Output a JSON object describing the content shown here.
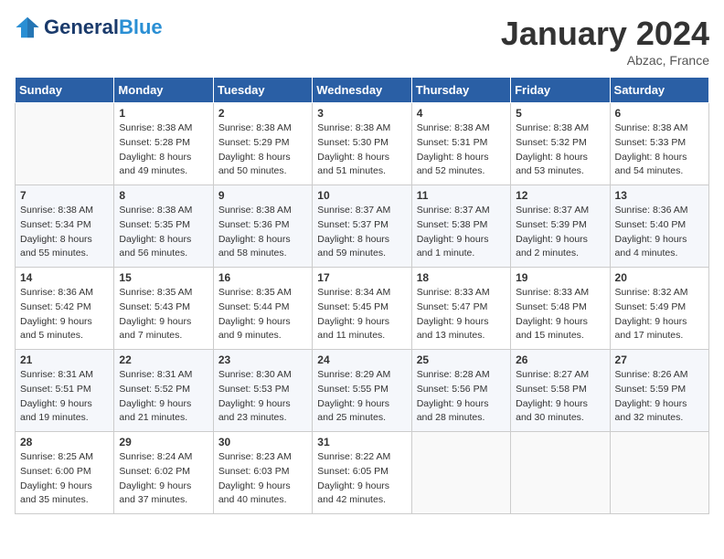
{
  "header": {
    "logo_general": "General",
    "logo_blue": "Blue",
    "month_title": "January 2024",
    "location": "Abzac, France"
  },
  "weekdays": [
    "Sunday",
    "Monday",
    "Tuesday",
    "Wednesday",
    "Thursday",
    "Friday",
    "Saturday"
  ],
  "weeks": [
    [
      {
        "day": "",
        "sunrise": "",
        "sunset": "",
        "daylight": ""
      },
      {
        "day": "1",
        "sunrise": "Sunrise: 8:38 AM",
        "sunset": "Sunset: 5:28 PM",
        "daylight": "Daylight: 8 hours and 49 minutes."
      },
      {
        "day": "2",
        "sunrise": "Sunrise: 8:38 AM",
        "sunset": "Sunset: 5:29 PM",
        "daylight": "Daylight: 8 hours and 50 minutes."
      },
      {
        "day": "3",
        "sunrise": "Sunrise: 8:38 AM",
        "sunset": "Sunset: 5:30 PM",
        "daylight": "Daylight: 8 hours and 51 minutes."
      },
      {
        "day": "4",
        "sunrise": "Sunrise: 8:38 AM",
        "sunset": "Sunset: 5:31 PM",
        "daylight": "Daylight: 8 hours and 52 minutes."
      },
      {
        "day": "5",
        "sunrise": "Sunrise: 8:38 AM",
        "sunset": "Sunset: 5:32 PM",
        "daylight": "Daylight: 8 hours and 53 minutes."
      },
      {
        "day": "6",
        "sunrise": "Sunrise: 8:38 AM",
        "sunset": "Sunset: 5:33 PM",
        "daylight": "Daylight: 8 hours and 54 minutes."
      }
    ],
    [
      {
        "day": "7",
        "sunrise": "Sunrise: 8:38 AM",
        "sunset": "Sunset: 5:34 PM",
        "daylight": "Daylight: 8 hours and 55 minutes."
      },
      {
        "day": "8",
        "sunrise": "Sunrise: 8:38 AM",
        "sunset": "Sunset: 5:35 PM",
        "daylight": "Daylight: 8 hours and 56 minutes."
      },
      {
        "day": "9",
        "sunrise": "Sunrise: 8:38 AM",
        "sunset": "Sunset: 5:36 PM",
        "daylight": "Daylight: 8 hours and 58 minutes."
      },
      {
        "day": "10",
        "sunrise": "Sunrise: 8:37 AM",
        "sunset": "Sunset: 5:37 PM",
        "daylight": "Daylight: 8 hours and 59 minutes."
      },
      {
        "day": "11",
        "sunrise": "Sunrise: 8:37 AM",
        "sunset": "Sunset: 5:38 PM",
        "daylight": "Daylight: 9 hours and 1 minute."
      },
      {
        "day": "12",
        "sunrise": "Sunrise: 8:37 AM",
        "sunset": "Sunset: 5:39 PM",
        "daylight": "Daylight: 9 hours and 2 minutes."
      },
      {
        "day": "13",
        "sunrise": "Sunrise: 8:36 AM",
        "sunset": "Sunset: 5:40 PM",
        "daylight": "Daylight: 9 hours and 4 minutes."
      }
    ],
    [
      {
        "day": "14",
        "sunrise": "Sunrise: 8:36 AM",
        "sunset": "Sunset: 5:42 PM",
        "daylight": "Daylight: 9 hours and 5 minutes."
      },
      {
        "day": "15",
        "sunrise": "Sunrise: 8:35 AM",
        "sunset": "Sunset: 5:43 PM",
        "daylight": "Daylight: 9 hours and 7 minutes."
      },
      {
        "day": "16",
        "sunrise": "Sunrise: 8:35 AM",
        "sunset": "Sunset: 5:44 PM",
        "daylight": "Daylight: 9 hours and 9 minutes."
      },
      {
        "day": "17",
        "sunrise": "Sunrise: 8:34 AM",
        "sunset": "Sunset: 5:45 PM",
        "daylight": "Daylight: 9 hours and 11 minutes."
      },
      {
        "day": "18",
        "sunrise": "Sunrise: 8:33 AM",
        "sunset": "Sunset: 5:47 PM",
        "daylight": "Daylight: 9 hours and 13 minutes."
      },
      {
        "day": "19",
        "sunrise": "Sunrise: 8:33 AM",
        "sunset": "Sunset: 5:48 PM",
        "daylight": "Daylight: 9 hours and 15 minutes."
      },
      {
        "day": "20",
        "sunrise": "Sunrise: 8:32 AM",
        "sunset": "Sunset: 5:49 PM",
        "daylight": "Daylight: 9 hours and 17 minutes."
      }
    ],
    [
      {
        "day": "21",
        "sunrise": "Sunrise: 8:31 AM",
        "sunset": "Sunset: 5:51 PM",
        "daylight": "Daylight: 9 hours and 19 minutes."
      },
      {
        "day": "22",
        "sunrise": "Sunrise: 8:31 AM",
        "sunset": "Sunset: 5:52 PM",
        "daylight": "Daylight: 9 hours and 21 minutes."
      },
      {
        "day": "23",
        "sunrise": "Sunrise: 8:30 AM",
        "sunset": "Sunset: 5:53 PM",
        "daylight": "Daylight: 9 hours and 23 minutes."
      },
      {
        "day": "24",
        "sunrise": "Sunrise: 8:29 AM",
        "sunset": "Sunset: 5:55 PM",
        "daylight": "Daylight: 9 hours and 25 minutes."
      },
      {
        "day": "25",
        "sunrise": "Sunrise: 8:28 AM",
        "sunset": "Sunset: 5:56 PM",
        "daylight": "Daylight: 9 hours and 28 minutes."
      },
      {
        "day": "26",
        "sunrise": "Sunrise: 8:27 AM",
        "sunset": "Sunset: 5:58 PM",
        "daylight": "Daylight: 9 hours and 30 minutes."
      },
      {
        "day": "27",
        "sunrise": "Sunrise: 8:26 AM",
        "sunset": "Sunset: 5:59 PM",
        "daylight": "Daylight: 9 hours and 32 minutes."
      }
    ],
    [
      {
        "day": "28",
        "sunrise": "Sunrise: 8:25 AM",
        "sunset": "Sunset: 6:00 PM",
        "daylight": "Daylight: 9 hours and 35 minutes."
      },
      {
        "day": "29",
        "sunrise": "Sunrise: 8:24 AM",
        "sunset": "Sunset: 6:02 PM",
        "daylight": "Daylight: 9 hours and 37 minutes."
      },
      {
        "day": "30",
        "sunrise": "Sunrise: 8:23 AM",
        "sunset": "Sunset: 6:03 PM",
        "daylight": "Daylight: 9 hours and 40 minutes."
      },
      {
        "day": "31",
        "sunrise": "Sunrise: 8:22 AM",
        "sunset": "Sunset: 6:05 PM",
        "daylight": "Daylight: 9 hours and 42 minutes."
      },
      {
        "day": "",
        "sunrise": "",
        "sunset": "",
        "daylight": ""
      },
      {
        "day": "",
        "sunrise": "",
        "sunset": "",
        "daylight": ""
      },
      {
        "day": "",
        "sunrise": "",
        "sunset": "",
        "daylight": ""
      }
    ]
  ]
}
